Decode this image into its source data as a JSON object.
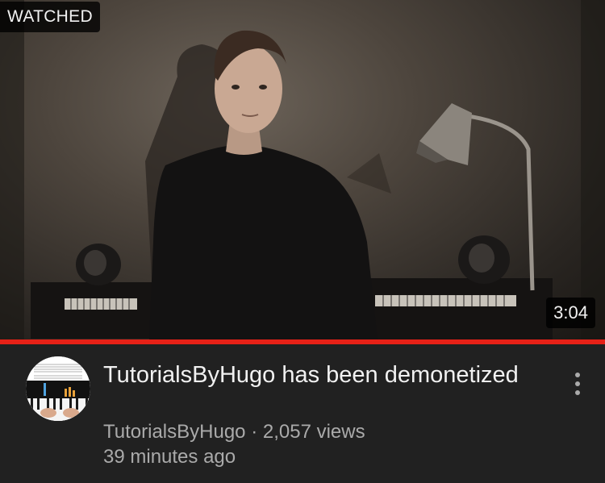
{
  "video": {
    "watched_label": "WATCHED",
    "duration": "3:04",
    "progress_fraction": 1.0,
    "title": "TutorialsByHugo has been demonetized",
    "channel": "TutorialsByHugo",
    "separator": "·",
    "views": "2,057 views",
    "age": "39 minutes ago"
  },
  "icons": {
    "more": "more-vert-icon"
  },
  "colors": {
    "background": "#212121",
    "progress": "#e62117",
    "primary_text": "#f1f1f1",
    "secondary_text": "#aaaaaa"
  }
}
